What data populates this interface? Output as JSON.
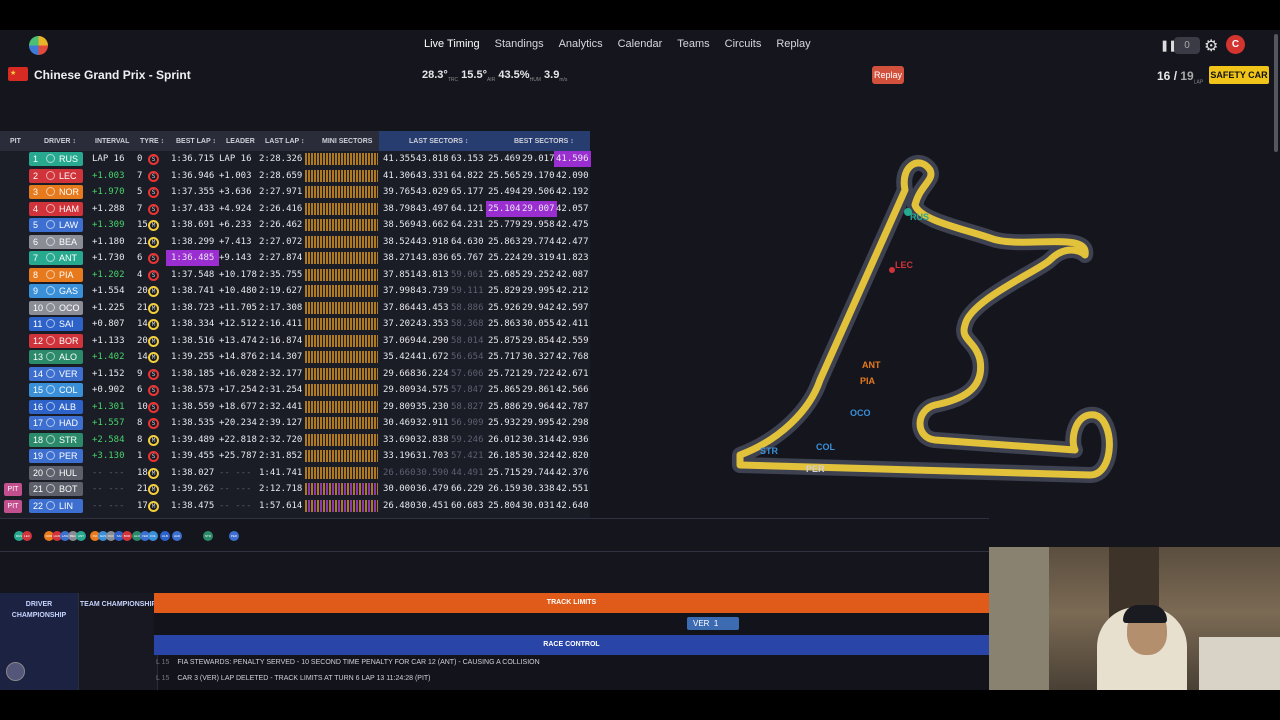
{
  "nav": {
    "items": [
      "Live Timing",
      "Standings",
      "Analytics",
      "Calendar",
      "Teams",
      "Circuits",
      "Replay"
    ],
    "active": "Live Timing",
    "toggle_value": "0",
    "avatar_letter": "C"
  },
  "session": {
    "title": "Chinese Grand Prix - Sprint",
    "track_temp": "28.3°",
    "track_temp_unit": "TRC",
    "air_temp": "15.5°",
    "air_temp_unit": "AIR",
    "humidity": "43.5%",
    "humidity_unit": "HUM",
    "wind": "3.9",
    "wind_unit": "m/s",
    "replay_label": "Replay",
    "lap_current": "16",
    "lap_total": "19",
    "lap_unit": "LAP",
    "flag_status": "SAFETY CAR"
  },
  "table": {
    "headers": {
      "pit": "PIT",
      "driver": "DRIVER ↕",
      "interval": "INTERVAL",
      "tyre": "TYRE ↕",
      "best_lap": "BEST LAP ↕",
      "leader": "LEADER",
      "last_lap": "LAST LAP ↕",
      "mini_sectors": "MINI SECTORS",
      "last_sectors": "LAST SECTORS ↕",
      "best_sectors": "BEST SECTORS ↕"
    },
    "rows": [
      {
        "pos": "1",
        "code": "RUS",
        "color": "#27a98f",
        "interval": "LAP 16",
        "stint": "0",
        "tyre": "S",
        "best": "1:36.715",
        "leader": "LAP 16",
        "last": "2:28.326",
        "ls": [
          "41.355",
          "43.818",
          "63.153"
        ],
        "bs": [
          "25.469",
          "29.017",
          "41.596"
        ],
        "pit": false,
        "best_purple": false,
        "int_green": false,
        "bs_purple": [
          false,
          false,
          true
        ]
      },
      {
        "pos": "2",
        "code": "LEC",
        "color": "#d0333a",
        "interval": "+1.003",
        "stint": "7",
        "tyre": "S",
        "best": "1:36.946",
        "leader": "+1.003",
        "last": "2:28.659",
        "ls": [
          "41.306",
          "43.331",
          "64.822"
        ],
        "bs": [
          "25.565",
          "29.170",
          "42.090"
        ],
        "pit": false,
        "best_purple": false,
        "int_green": true,
        "bs_purple": [
          false,
          false,
          false
        ]
      },
      {
        "pos": "3",
        "code": "NOR",
        "color": "#e67a1c",
        "interval": "+1.970",
        "stint": "5",
        "tyre": "S",
        "best": "1:37.355",
        "leader": "+3.636",
        "last": "2:27.971",
        "ls": [
          "39.765",
          "43.029",
          "65.177"
        ],
        "bs": [
          "25.494",
          "29.506",
          "42.192"
        ],
        "pit": false,
        "best_purple": false,
        "int_green": true,
        "bs_purple": [
          false,
          false,
          false
        ]
      },
      {
        "pos": "4",
        "code": "HAM",
        "color": "#d0333a",
        "interval": "+1.288",
        "stint": "7",
        "tyre": "S",
        "best": "1:37.433",
        "leader": "+4.924",
        "last": "2:26.416",
        "ls": [
          "38.798",
          "43.497",
          "64.121"
        ],
        "bs": [
          "25.104",
          "29.007",
          "42.057"
        ],
        "pit": false,
        "best_purple": false,
        "int_green": false,
        "bs_purple": [
          true,
          true,
          false
        ]
      },
      {
        "pos": "5",
        "code": "LAW",
        "color": "#3c6fcf",
        "interval": "+1.309",
        "stint": "15",
        "tyre": "M",
        "best": "1:38.691",
        "leader": "+6.233",
        "last": "2:26.462",
        "ls": [
          "38.569",
          "43.662",
          "64.231"
        ],
        "bs": [
          "25.779",
          "29.958",
          "42.475"
        ],
        "pit": false,
        "best_purple": false,
        "int_green": true,
        "bs_purple": [
          false,
          false,
          false
        ]
      },
      {
        "pos": "6",
        "code": "BEA",
        "color": "#8a8c96",
        "interval": "+1.180",
        "stint": "21",
        "tyre": "M",
        "best": "1:38.299",
        "leader": "+7.413",
        "last": "2:27.072",
        "ls": [
          "38.524",
          "43.918",
          "64.630"
        ],
        "bs": [
          "25.863",
          "29.774",
          "42.477"
        ],
        "pit": false,
        "best_purple": false,
        "int_green": false,
        "bs_purple": [
          false,
          false,
          false
        ]
      },
      {
        "pos": "7",
        "code": "ANT",
        "color": "#27a98f",
        "interval": "+1.730",
        "stint": "6",
        "tyre": "S",
        "best": "1:36.485",
        "leader": "+9.143",
        "last": "2:27.874",
        "ls": [
          "38.271",
          "43.836",
          "65.767"
        ],
        "bs": [
          "25.224",
          "29.319",
          "41.823"
        ],
        "pit": false,
        "best_purple": true,
        "int_green": false,
        "bs_purple": [
          false,
          false,
          false
        ]
      },
      {
        "pos": "8",
        "code": "PIA",
        "color": "#e67a1c",
        "interval": "+1.202",
        "stint": "4",
        "tyre": "S",
        "best": "1:37.548",
        "leader": "+10.178",
        "last": "2:35.755",
        "ls": [
          "37.851",
          "43.813",
          "59.061"
        ],
        "bs": [
          "25.685",
          "29.252",
          "42.087"
        ],
        "pit": false,
        "best_purple": false,
        "int_green": true,
        "bs_purple": [
          false,
          false,
          false
        ]
      },
      {
        "pos": "9",
        "code": "GAS",
        "color": "#3a8fd9",
        "interval": "+1.554",
        "stint": "20",
        "tyre": "M",
        "best": "1:38.741",
        "leader": "+10.480",
        "last": "2:19.627",
        "ls": [
          "37.998",
          "43.739",
          "59.111"
        ],
        "bs": [
          "25.829",
          "29.995",
          "42.212"
        ],
        "pit": false,
        "best_purple": false,
        "int_green": false,
        "bs_purple": [
          false,
          false,
          false
        ]
      },
      {
        "pos": "10",
        "code": "OCO",
        "color": "#8a8c96",
        "interval": "+1.225",
        "stint": "21",
        "tyre": "M",
        "best": "1:38.723",
        "leader": "+11.705",
        "last": "2:17.308",
        "ls": [
          "37.864",
          "43.453",
          "58.886"
        ],
        "bs": [
          "25.926",
          "29.942",
          "42.597"
        ],
        "pit": false,
        "best_purple": false,
        "int_green": false,
        "bs_purple": [
          false,
          false,
          false
        ]
      },
      {
        "pos": "11",
        "code": "SAI",
        "color": "#2d63c8",
        "interval": "+0.807",
        "stint": "14",
        "tyre": "M",
        "best": "1:38.334",
        "leader": "+12.512",
        "last": "2:16.411",
        "ls": [
          "37.202",
          "43.353",
          "58.368"
        ],
        "bs": [
          "25.863",
          "30.055",
          "42.411"
        ],
        "pit": false,
        "best_purple": false,
        "int_green": false,
        "bs_purple": [
          false,
          false,
          false
        ]
      },
      {
        "pos": "12",
        "code": "BOR",
        "color": "#d0333a",
        "interval": "+1.133",
        "stint": "20",
        "tyre": "M",
        "best": "1:38.516",
        "leader": "+13.474",
        "last": "2:16.874",
        "ls": [
          "37.069",
          "44.290",
          "58.014"
        ],
        "bs": [
          "25.875",
          "29.854",
          "42.559"
        ],
        "pit": false,
        "best_purple": false,
        "int_green": false,
        "bs_purple": [
          false,
          false,
          false
        ]
      },
      {
        "pos": "13",
        "code": "ALO",
        "color": "#2a8a6a",
        "interval": "+1.402",
        "stint": "14",
        "tyre": "M",
        "best": "1:39.255",
        "leader": "+14.876",
        "last": "2:14.307",
        "ls": [
          "35.424",
          "41.672",
          "56.654"
        ],
        "bs": [
          "25.717",
          "30.327",
          "42.768"
        ],
        "pit": false,
        "best_purple": false,
        "int_green": true,
        "bs_purple": [
          false,
          false,
          false
        ]
      },
      {
        "pos": "14",
        "code": "VER",
        "color": "#3c6fcf",
        "interval": "+1.152",
        "stint": "9",
        "tyre": "S",
        "best": "1:38.185",
        "leader": "+16.028",
        "last": "2:32.177",
        "ls": [
          "29.668",
          "36.224",
          "57.606"
        ],
        "bs": [
          "25.721",
          "29.722",
          "42.671"
        ],
        "pit": false,
        "best_purple": false,
        "int_green": false,
        "bs_purple": [
          false,
          false,
          false
        ]
      },
      {
        "pos": "15",
        "code": "COL",
        "color": "#3a8fd9",
        "interval": "+0.902",
        "stint": "6",
        "tyre": "S",
        "best": "1:38.573",
        "leader": "+17.254",
        "last": "2:31.254",
        "ls": [
          "29.809",
          "34.575",
          "57.847"
        ],
        "bs": [
          "25.865",
          "29.861",
          "42.566"
        ],
        "pit": false,
        "best_purple": false,
        "int_green": false,
        "bs_purple": [
          false,
          false,
          false
        ]
      },
      {
        "pos": "16",
        "code": "ALB",
        "color": "#2d63c8",
        "interval": "+1.301",
        "stint": "10",
        "tyre": "S",
        "best": "1:38.559",
        "leader": "+18.677",
        "last": "2:32.441",
        "ls": [
          "29.809",
          "35.230",
          "58.827"
        ],
        "bs": [
          "25.886",
          "29.964",
          "42.787"
        ],
        "pit": false,
        "best_purple": false,
        "int_green": true,
        "bs_purple": [
          false,
          false,
          false
        ]
      },
      {
        "pos": "17",
        "code": "HAD",
        "color": "#3c6fcf",
        "interval": "+1.557",
        "stint": "8",
        "tyre": "S",
        "best": "1:38.535",
        "leader": "+20.234",
        "last": "2:39.127",
        "ls": [
          "30.469",
          "32.911",
          "56.909"
        ],
        "bs": [
          "25.932",
          "29.995",
          "42.298"
        ],
        "pit": false,
        "best_purple": false,
        "int_green": true,
        "bs_purple": [
          false,
          false,
          false
        ]
      },
      {
        "pos": "18",
        "code": "STR",
        "color": "#2a8a6a",
        "interval": "+2.584",
        "stint": "8",
        "tyre": "M",
        "best": "1:39.489",
        "leader": "+22.818",
        "last": "2:32.720",
        "ls": [
          "33.690",
          "32.838",
          "59.246"
        ],
        "bs": [
          "26.012",
          "30.314",
          "42.936"
        ],
        "pit": false,
        "best_purple": false,
        "int_green": true,
        "bs_purple": [
          false,
          false,
          false
        ]
      },
      {
        "pos": "19",
        "code": "PER",
        "color": "#3c6fcf",
        "interval": "+3.130",
        "stint": "1",
        "tyre": "S",
        "best": "1:39.455",
        "leader": "+25.787",
        "last": "2:31.852",
        "ls": [
          "33.196",
          "31.703",
          "57.421"
        ],
        "bs": [
          "26.185",
          "30.324",
          "42.820"
        ],
        "pit": false,
        "best_purple": false,
        "int_green": true,
        "bs_purple": [
          false,
          false,
          false
        ]
      },
      {
        "pos": "20",
        "code": "HUL",
        "color": "#5d5f6a",
        "interval": "-- ---",
        "stint": "18",
        "tyre": "M",
        "best": "1:38.027",
        "leader": "-- ---",
        "last": "1:41.741",
        "ls": [
          "26.660",
          "30.590",
          "44.491"
        ],
        "bs": [
          "25.715",
          "29.744",
          "42.376"
        ],
        "pit": false,
        "best_purple": false,
        "int_green": false,
        "bs_purple": [
          false,
          false,
          false
        ]
      },
      {
        "pos": "21",
        "code": "BOT",
        "color": "#5d5f6a",
        "interval": "-- ---",
        "stint": "21",
        "tyre": "M",
        "best": "1:39.262",
        "leader": "-- ---",
        "last": "2:12.718",
        "ls": [
          "30.000",
          "36.479",
          "66.229"
        ],
        "bs": [
          "26.159",
          "30.338",
          "42.551"
        ],
        "pit": true,
        "best_purple": false,
        "int_green": false,
        "bs_purple": [
          false,
          false,
          false
        ]
      },
      {
        "pos": "22",
        "code": "LIN",
        "color": "#3c6fcf",
        "interval": "-- ---",
        "stint": "17",
        "tyre": "M",
        "best": "1:38.475",
        "leader": "-- ---",
        "last": "1:57.614",
        "ls": [
          "26.480",
          "30.451",
          "60.683"
        ],
        "bs": [
          "25.804",
          "30.031",
          "42.640"
        ],
        "pit": true,
        "best_purple": false,
        "int_green": false,
        "bs_purple": [
          false,
          false,
          false
        ]
      }
    ],
    "pit_label": "PIT"
  },
  "track_map": {
    "labels": [
      "RUS",
      "LEC",
      "ANT",
      "PIA",
      "OCO",
      "STR",
      "COL",
      "PER"
    ],
    "track_color": "#e2c13b",
    "outline_color": "#3d4150"
  },
  "gap_strip": {
    "dots": [
      "RUS",
      "LEC",
      "NOR",
      "HAM",
      "LAW",
      "BEA",
      "ANT",
      "PIA",
      "GAS",
      "OCO",
      "SAI",
      "BOR",
      "ALO",
      "VER",
      "COL",
      "ALB",
      "HAD",
      "STR",
      "PER"
    ]
  },
  "bottom": {
    "driver_championship": "DRIVER CHAMPIONSHIP",
    "team_championship": "TEAM CHAMPIONSHIP",
    "track_limits_title": "TRACK LIMITS",
    "track_limits_driver": "VER",
    "track_limits_count": "1",
    "race_control_title": "RACE CONTROL",
    "messages": [
      {
        "lap": "L 15",
        "text": "FIA STEWARDS: PENALTY SERVED - 10 SECOND TIME PENALTY FOR CAR 12 (ANT) - CAUSING A COLLISION"
      },
      {
        "lap": "L 15",
        "text": "CAR 3 (VER) LAP DELETED - TRACK LIMITS AT TURN 6 LAP 13 11:24:28 (PIT)"
      }
    ]
  }
}
